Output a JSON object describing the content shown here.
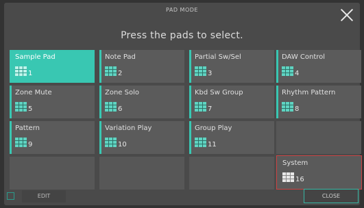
{
  "header": {
    "title": "PAD MODE",
    "prompt": "Press the pads to select."
  },
  "pads": [
    {
      "label": "Sample Pad",
      "number": "1"
    },
    {
      "label": "Note Pad",
      "number": "2"
    },
    {
      "label": "Partial Sw/Sel",
      "number": "3"
    },
    {
      "label": "DAW Control",
      "number": "4"
    },
    {
      "label": "Zone Mute",
      "number": "5"
    },
    {
      "label": "Zone Solo",
      "number": "6"
    },
    {
      "label": "Kbd Sw Group",
      "number": "7"
    },
    {
      "label": "Rhythm Pattern",
      "number": "8"
    },
    {
      "label": "Pattern",
      "number": "9"
    },
    {
      "label": "Variation Play",
      "number": "10"
    },
    {
      "label": "Group Play",
      "number": "11"
    },
    {
      "label": "System",
      "number": "16"
    }
  ],
  "footer": {
    "edit_label": "EDIT",
    "close_label": "CLOSE"
  },
  "colors": {
    "accent": "#39c7b2",
    "selected_pad": "#39c7b2",
    "system_outline": "#cc4444"
  }
}
